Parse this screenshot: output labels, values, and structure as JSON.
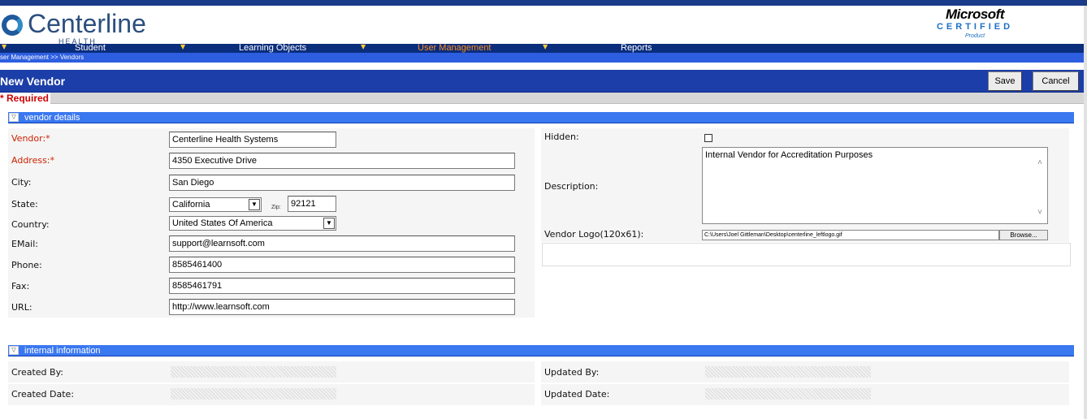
{
  "header": {
    "logo_name": "Centerline",
    "logo_sub": "HEALTH SYSTEMS",
    "ms_name": "Microsoft",
    "ms_cert": "CERTIFIED",
    "ms_product": "Product"
  },
  "nav": {
    "items": [
      {
        "label": "Student",
        "active": false
      },
      {
        "label": "Learning Objects",
        "active": false
      },
      {
        "label": "User Management",
        "active": true
      },
      {
        "label": "Reports",
        "active": false
      }
    ],
    "arrow_glyph": "▼"
  },
  "breadcrumb": "ser Management >> Vendors",
  "page": {
    "title": "New Vendor",
    "save_label": "Save",
    "cancel_label": "Cancel",
    "required_text": "* Required"
  },
  "vendor_details": {
    "section_label": "vendor details",
    "vendor_label": "Vendor:*",
    "vendor_value": "Centerline Health Systems",
    "address_label": "Address:*",
    "address_value": "4350 Executive Drive",
    "city_label": "City:",
    "city_value": "San Diego",
    "state_label": "State:",
    "state_value": "California",
    "zip_label": "Zip:",
    "zip_value": "92121",
    "country_label": "Country:",
    "country_value": "United States Of America",
    "email_label": "EMail:",
    "email_value": "support@learnsoft.com",
    "phone_label": "Phone:",
    "phone_value": "8585461400",
    "fax_label": "Fax:",
    "fax_value": "8585461791",
    "url_label": "URL:",
    "url_value": "http://www.learnsoft.com",
    "hidden_label": "Hidden:",
    "hidden_checked": false,
    "description_label": "Description:",
    "description_value": "Internal Vendor for Accreditation Purposes",
    "logo_label": "Vendor Logo(120x61):",
    "logo_path": "C:\\Users\\Joel Gittleman\\Desktop\\centerline_leftlogo.gif",
    "browse_label": "Browse..."
  },
  "internal_info": {
    "section_label": "internal information",
    "created_by_label": "Created By:",
    "created_date_label": "Created Date:",
    "updated_by_label": "Updated By:",
    "updated_date_label": "Updated Date:"
  },
  "icons": {
    "toggle": "collapse-triangle-icon",
    "dropdown": "chevron-down-icon",
    "scroll_up": "chevron-up-icon"
  },
  "colors": {
    "nav_bg": "#0a2d7c",
    "nav_active": "#ff8c1a",
    "titlebar_bg": "#1c3ea8",
    "section_bg": "#3a78f0",
    "required_red": "#cc0000"
  }
}
